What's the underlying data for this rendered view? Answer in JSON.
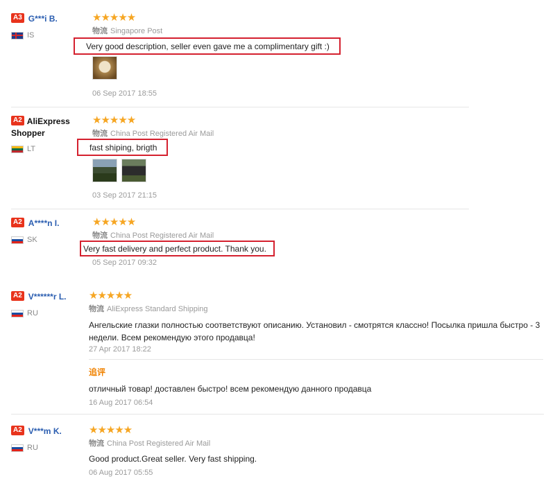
{
  "colors": {
    "level_badge": "#e8331c",
    "name_link": "#2a5db0",
    "stars": "#f6a623",
    "highlight_box": "#d4202e",
    "followup": "#f08200"
  },
  "reviews": [
    {
      "level": "A3",
      "name": "G***i B.",
      "country": "IS",
      "flag_icon": "iceland-flag-icon",
      "rating": "★★★★★",
      "shipping_label": "物流",
      "shipping": "Singapore Post",
      "text": "Very good description, seller even gave me a complimentary gift :)",
      "date": "06 Sep 2017 18:55"
    },
    {
      "level": "A2",
      "name_line1": "AliExpress",
      "name_line2": "Shopper",
      "country": "LT",
      "flag_icon": "lithuania-flag-icon",
      "rating": "★★★★★",
      "shipping_label": "物流",
      "shipping": "China Post Registered Air Mail",
      "text": "fast shiping, brigth",
      "date": "03 Sep 2017 21:15"
    },
    {
      "level": "A2",
      "name": "A****n I.",
      "country": "SK",
      "flag_icon": "slovakia-flag-icon",
      "rating": "★★★★★",
      "shipping_label": "物流",
      "shipping": "China Post Registered Air Mail",
      "text": "Very fast delivery and perfect product. Thank you.",
      "date": "05 Sep 2017 09:32"
    },
    {
      "level": "A2",
      "name": "V******r L.",
      "country": "RU",
      "flag_icon": "russia-flag-icon",
      "rating": "★★★★★",
      "shipping_label": "物流",
      "shipping": "AliExpress Standard Shipping",
      "text": "Ангельские глазки полностью соответствуют описанию. Установил - смотрятся классно! Посылка пришла быстро - 3 недели. Всем рекомендую этого продавца!",
      "date": "27 Apr 2017 18:22",
      "followup_label": "追评",
      "followup_text": "отличный товар! доставлен быстро! всем рекомендую данного продавца",
      "followup_date": "16 Aug 2017 06:54"
    },
    {
      "level": "A2",
      "name": "V***m K.",
      "country": "RU",
      "flag_icon": "russia-flag-icon",
      "rating": "★★★★★",
      "shipping_label": "物流",
      "shipping": "China Post Registered Air Mail",
      "text": "Good product.Great seller. Very fast shipping.",
      "date": "06 Aug 2017 05:55"
    }
  ]
}
